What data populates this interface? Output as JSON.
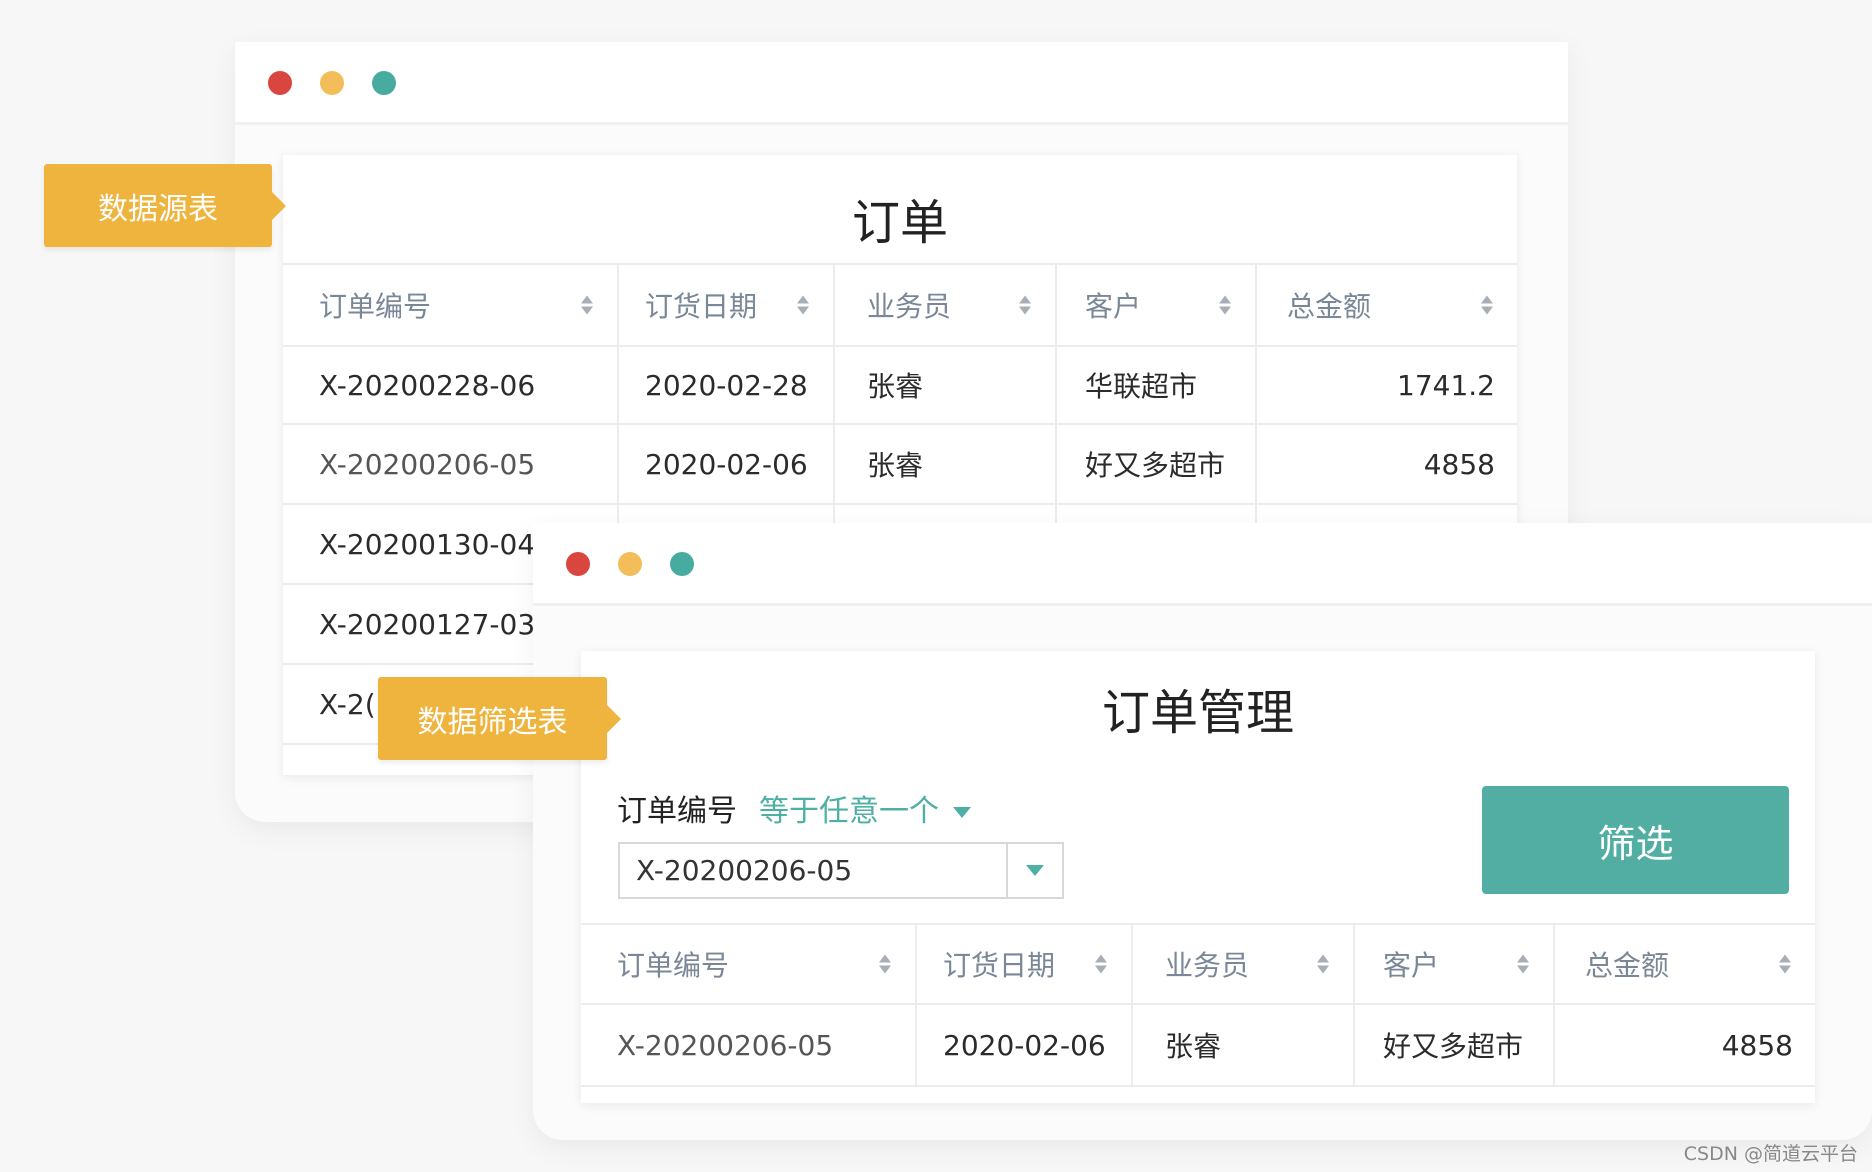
{
  "source_window": {
    "title": "订单",
    "columns": [
      "订单编号",
      "订货日期",
      "业务员",
      "客户",
      "总金额"
    ],
    "rows": [
      [
        "X-20200228-06",
        "2020-02-28",
        "张睿",
        "华联超市",
        "1741.2"
      ],
      [
        "X-20200206-05",
        "2020-02-06",
        "张睿",
        "好又多超市",
        "4858"
      ],
      [
        "X-20200130-04",
        "",
        "",
        "",
        ""
      ],
      [
        "X-20200127-03",
        "",
        "",
        "",
        ""
      ],
      [
        "X-2(",
        "",
        "",
        "",
        ""
      ]
    ]
  },
  "tags": {
    "source": "数据源表",
    "filter": "数据筛选表"
  },
  "filter_window": {
    "title": "订单管理",
    "filter_field": "订单编号",
    "filter_operator": "等于任意一个",
    "filter_value": "X-20200206-05",
    "filter_button": "筛选",
    "columns": [
      "订单编号",
      "订货日期",
      "业务员",
      "客户",
      "总金额"
    ],
    "rows": [
      [
        "X-20200206-05",
        "2020-02-06",
        "张睿",
        "好又多超市",
        "4858"
      ]
    ]
  },
  "colors": {
    "red": "#d9463f",
    "yellow": "#f3bd5a",
    "green": "#47ab9f",
    "accent": "#52aea3",
    "tag": "#eeb43e"
  },
  "watermark": "CSDN @简道云平台"
}
